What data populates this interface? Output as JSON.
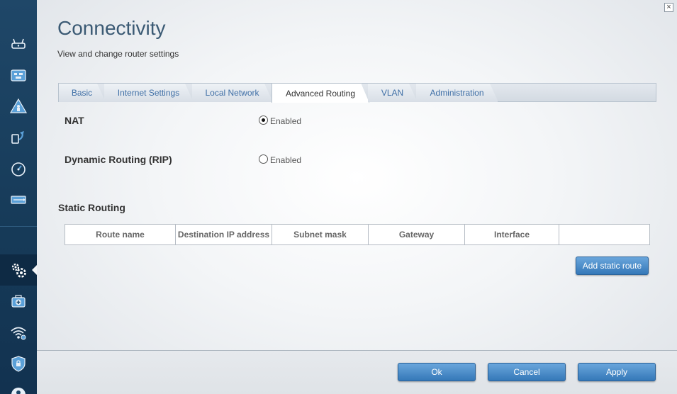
{
  "header": {
    "title": "Connectivity",
    "subtitle": "View and change router settings"
  },
  "tabs": [
    {
      "label": "Basic",
      "active": false
    },
    {
      "label": "Internet Settings",
      "active": false
    },
    {
      "label": "Local Network",
      "active": false
    },
    {
      "label": "Advanced Routing",
      "active": true
    },
    {
      "label": "VLAN",
      "active": false
    },
    {
      "label": "Administration",
      "active": false
    }
  ],
  "settings": {
    "nat": {
      "label": "NAT",
      "option": "Enabled",
      "checked": true
    },
    "rip": {
      "label": "Dynamic Routing (RIP)",
      "option": "Enabled",
      "checked": false
    }
  },
  "static_routing": {
    "title": "Static Routing",
    "columns": [
      "Route name",
      "Destination IP address",
      "Subnet mask",
      "Gateway",
      "Interface",
      ""
    ],
    "add_button": "Add static route"
  },
  "footer": {
    "ok": "Ok",
    "cancel": "Cancel",
    "apply": "Apply"
  },
  "sidebar_icons": [
    "router-icon",
    "device-list-icon",
    "parental-controls-icon",
    "media-prioritization-icon",
    "speed-test-icon",
    "usb-storage-icon",
    "connectivity-gear-icon",
    "troubleshooting-icon",
    "wireless-icon",
    "security-icon",
    "account-icon"
  ],
  "colors": {
    "sidebar": "#1f4768",
    "title": "#3b5a74",
    "tab_link": "#3f6fa6",
    "button": "#3478b8"
  },
  "close_glyph": "×"
}
